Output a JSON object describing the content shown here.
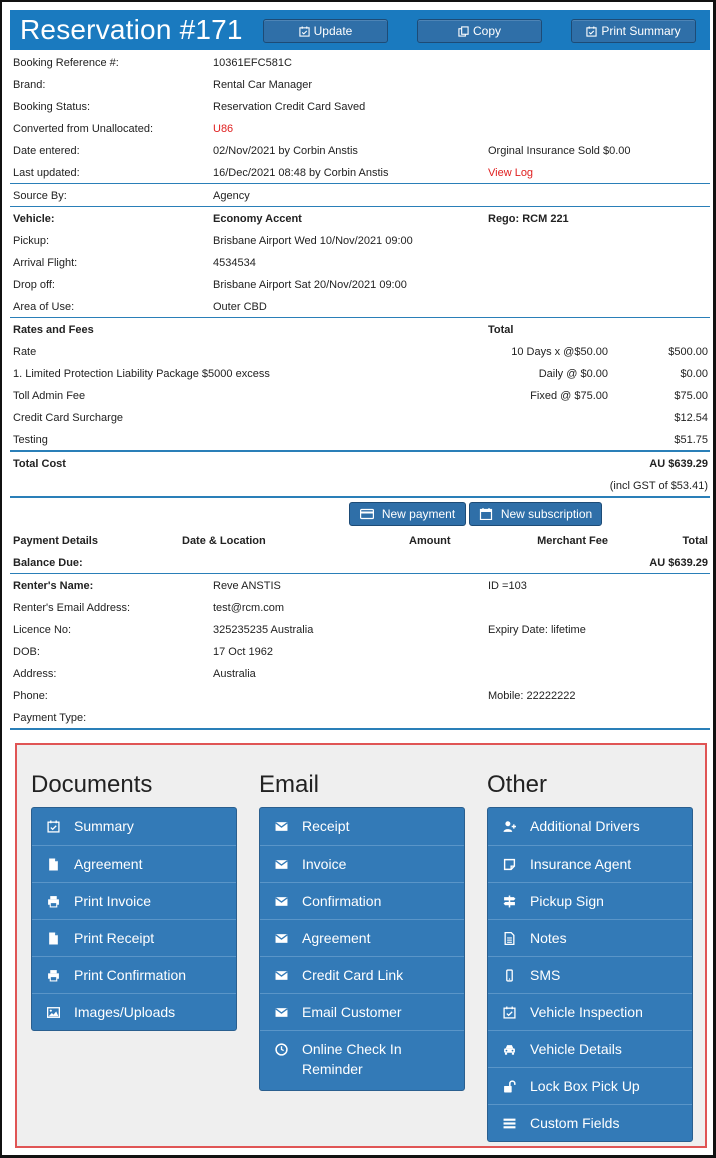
{
  "header": {
    "title": "Reservation #171",
    "update_label": "Update",
    "copy_label": "Copy",
    "print_summary_label": "Print Summary"
  },
  "booking": {
    "ref_label": "Booking Reference #:",
    "ref_value": "10361EFC581C",
    "brand_label": "Brand:",
    "brand_value": "Rental Car Manager",
    "status_label": "Booking Status:",
    "status_value": "Reservation Credit Card Saved",
    "converted_label": "Converted from Unallocated:",
    "converted_value": "U86",
    "entered_label": "Date entered:",
    "entered_value": "02/Nov/2021 by Corbin Anstis",
    "insurance_note": "Orginal Insurance Sold $0.00",
    "updated_label": "Last updated:",
    "updated_value": "16/Dec/2021 08:48 by Corbin Anstis",
    "view_log": "View Log",
    "source_label": "Source By:",
    "source_value": "Agency"
  },
  "vehicle": {
    "label": "Vehicle:",
    "value": "Economy Accent",
    "rego": "Rego: RCM 221",
    "pickup_label": "Pickup:",
    "pickup_value": "Brisbane Airport Wed 10/Nov/2021 09:00",
    "flight_label": "Arrival Flight:",
    "flight_value": "4534534",
    "dropoff_label": "Drop off:",
    "dropoff_value": "Brisbane Airport Sat 20/Nov/2021 09:00",
    "area_label": "Area of Use:",
    "area_value": "Outer CBD"
  },
  "rates": {
    "heading": "Rates and Fees",
    "total_heading": "Total",
    "lines": [
      {
        "name": "Rate",
        "detail": "10 Days x @$50.00",
        "total": "$500.00"
      },
      {
        "name": "1. Limited Protection Liability Package $5000 excess",
        "detail": "Daily @ $0.00",
        "total": "$0.00"
      },
      {
        "name": "Toll Admin Fee",
        "detail": "Fixed @ $75.00",
        "total": "$75.00"
      },
      {
        "name": "Credit Card Surcharge",
        "detail": "",
        "total": "$12.54"
      },
      {
        "name": "Testing",
        "detail": "",
        "total": "$51.75"
      }
    ],
    "total_cost_label": "Total Cost",
    "total_cost_value": "AU $639.29",
    "gst_note": "(incl GST of $53.41)"
  },
  "payment": {
    "new_payment_label": "New payment",
    "new_subscription_label": "New subscription",
    "col_details": "Payment Details",
    "col_date": "Date & Location",
    "col_amount": "Amount",
    "col_fee": "Merchant Fee",
    "col_total": "Total",
    "balance_label": "Balance Due:",
    "balance_value": "AU $639.29"
  },
  "renter": {
    "name_label": "Renter's Name:",
    "name_value": "Reve ANSTIS",
    "id_value": "ID =103",
    "email_label": "Renter's Email Address:",
    "email_value": "test@rcm.com",
    "licence_label": "Licence No:",
    "licence_value": "325235235 Australia",
    "expiry_value": "Expiry Date: lifetime",
    "dob_label": "DOB:",
    "dob_value": "17 Oct 1962",
    "address_label": "Address:",
    "address_value": "Australia",
    "phone_label": "Phone:",
    "mobile_value": "Mobile: 22222222",
    "payment_type_label": "Payment Type:"
  },
  "actions": {
    "documents": {
      "heading": "Documents",
      "items": [
        {
          "label": "Summary",
          "icon": "calendar-check-icon"
        },
        {
          "label": "Agreement",
          "icon": "file-icon"
        },
        {
          "label": "Print Invoice",
          "icon": "print-icon"
        },
        {
          "label": "Print Receipt",
          "icon": "file-icon"
        },
        {
          "label": "Print Confirmation",
          "icon": "print-icon"
        },
        {
          "label": "Images/Uploads",
          "icon": "image-icon"
        }
      ]
    },
    "email": {
      "heading": "Email",
      "items": [
        {
          "label": "Receipt",
          "icon": "envelope-icon"
        },
        {
          "label": "Invoice",
          "icon": "envelope-icon"
        },
        {
          "label": "Confirmation",
          "icon": "envelope-icon"
        },
        {
          "label": "Agreement",
          "icon": "envelope-icon"
        },
        {
          "label": "Credit Card Link",
          "icon": "envelope-icon"
        },
        {
          "label": "Email Customer",
          "icon": "envelope-icon"
        },
        {
          "label": "Online Check In Reminder",
          "icon": "clock-icon"
        }
      ]
    },
    "other": {
      "heading": "Other",
      "items": [
        {
          "label": "Additional Drivers",
          "icon": "user-plus-icon"
        },
        {
          "label": "Insurance Agent",
          "icon": "sticky-note-icon"
        },
        {
          "label": "Pickup Sign",
          "icon": "signpost-icon"
        },
        {
          "label": "Notes",
          "icon": "document-text-icon"
        },
        {
          "label": "SMS",
          "icon": "mobile-icon"
        },
        {
          "label": "Vehicle Inspection",
          "icon": "calendar-check-icon"
        },
        {
          "label": "Vehicle Details",
          "icon": "car-icon"
        },
        {
          "label": "Lock Box Pick Up",
          "icon": "unlock-icon"
        },
        {
          "label": "Custom Fields",
          "icon": "list-icon"
        }
      ]
    }
  },
  "colors": {
    "header_bg": "#1a7abf",
    "button_bg": "#337ab7",
    "link_red": "#e02020",
    "highlight_border": "#e05555"
  }
}
